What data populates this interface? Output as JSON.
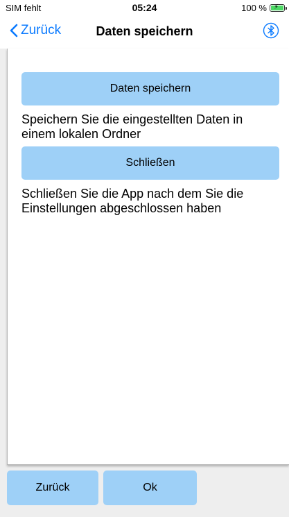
{
  "status_bar": {
    "carrier": "SIM fehlt",
    "time": "05:24",
    "battery": "100 %",
    "battery_color": "#4cd964"
  },
  "nav": {
    "back_label": "Zurück",
    "title": "Daten speichern",
    "right_icon": "bluetooth-icon",
    "accent_color": "#0a7aff"
  },
  "main": {
    "save_button_label": "Daten speichern",
    "save_description": "Speichern Sie die eingestellten Daten in einem lokalen Ordner",
    "close_button_label": "Schließen",
    "close_description": "Schließen Sie die App nach dem Sie die Einstellungen abgeschlossen haben",
    "button_color": "#9ed0f7"
  },
  "footer": {
    "back_label": "Zurück",
    "ok_label": "Ok"
  }
}
